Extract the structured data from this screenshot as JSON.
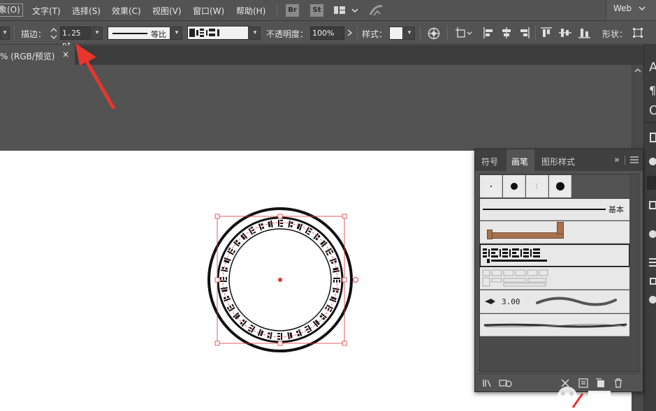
{
  "menubar": {
    "items": [
      "象(O)",
      "文字(T)",
      "选择(S)",
      "效果(C)",
      "视图(V)",
      "窗口(W)",
      "帮助(H)"
    ],
    "app_br": "Br",
    "app_st": "St",
    "workspace": "Web"
  },
  "controlbar": {
    "stroke_label": "描边：",
    "stroke_value": "1.25 pt",
    "profile_label": "等比",
    "opacity_label": "不透明度：",
    "opacity_value": "100%",
    "style_label": "样式：",
    "shape_label": "形状："
  },
  "document": {
    "tab_label": "% (RGB/预览)",
    "close_glyph": "×"
  },
  "brushes_panel": {
    "tabs": [
      "符号",
      "画笔",
      "图形样式"
    ],
    "active_tab": "画笔",
    "menu_glyph": "»",
    "basic_label": "基本",
    "scatter_value": "3.00"
  },
  "colors": {
    "ui_dark": "#535353",
    "artboard": "#ffffff",
    "selection": "#e0353b",
    "annotation_arrow": "#e8352e"
  }
}
